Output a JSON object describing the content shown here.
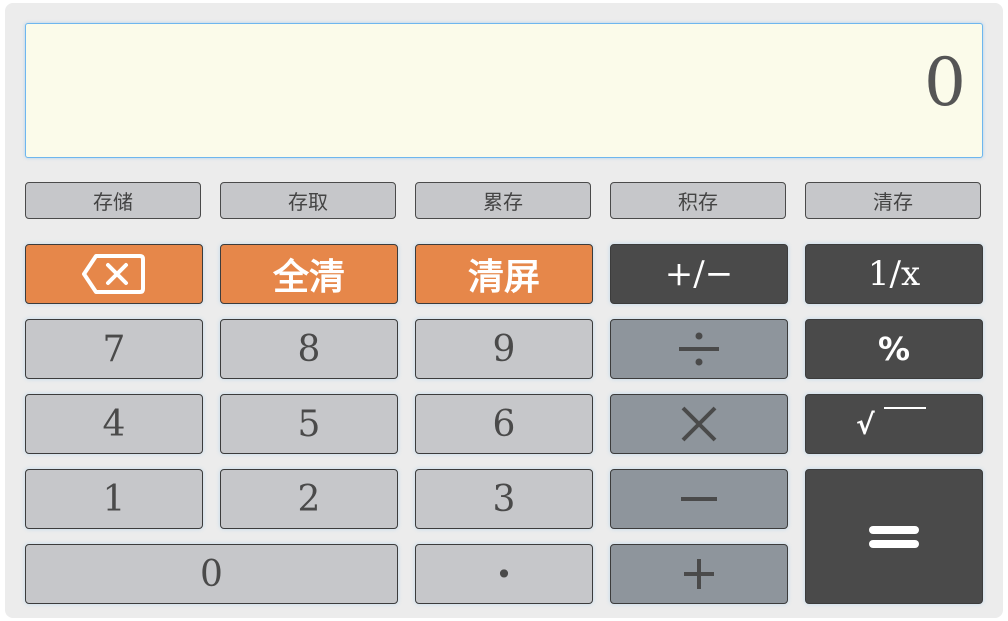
{
  "display": {
    "value": "0"
  },
  "memory_buttons": [
    {
      "label": "存储"
    },
    {
      "label": "存取"
    },
    {
      "label": "累存"
    },
    {
      "label": "积存"
    },
    {
      "label": "清存"
    }
  ],
  "keys": {
    "backspace": {
      "icon": "backspace-icon"
    },
    "clear_all": "全清",
    "clear_screen": "清屏",
    "negate": "+/−",
    "reciprocal": "1/x",
    "seven": "7",
    "eight": "8",
    "nine": "9",
    "divide": {
      "icon": "divide-icon"
    },
    "percent": "%",
    "four": "4",
    "five": "5",
    "six": "6",
    "multiply": {
      "icon": "multiply-icon"
    },
    "sqrt": "√",
    "one": "1",
    "two": "2",
    "three": "3",
    "minus": {
      "icon": "minus-icon"
    },
    "equals": {
      "icon": "equals-icon"
    },
    "zero": "0",
    "decimal": "•",
    "plus": {
      "icon": "plus-icon"
    }
  },
  "colors": {
    "display_bg": "#fbfbea",
    "orange": "#e6874a",
    "dark": "#4a4a4a",
    "light_gray": "#c6c7ca",
    "operator_gray": "#8e959c"
  }
}
